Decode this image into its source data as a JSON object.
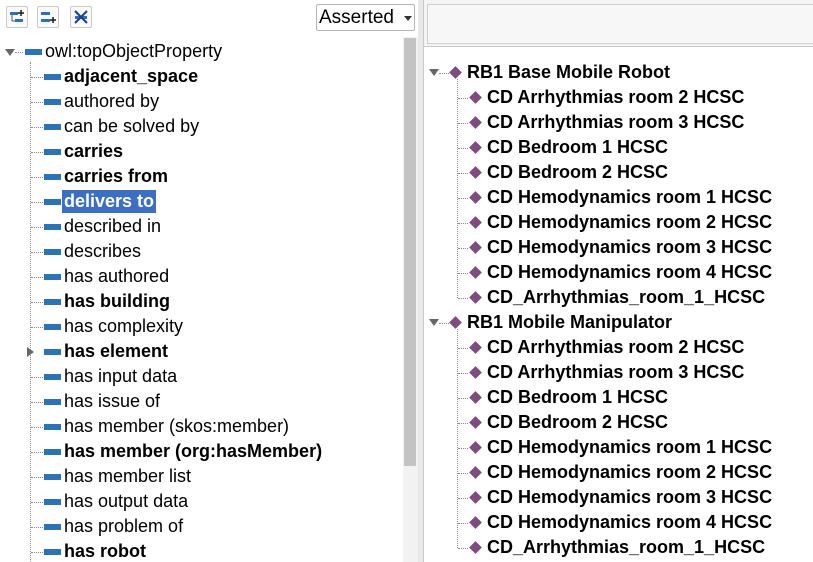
{
  "toolbar": {
    "buttons": [
      {
        "icon": "add-sub-property-icon"
      },
      {
        "icon": "add-sibling-property-icon"
      },
      {
        "icon": "delete-property-icon"
      }
    ],
    "view_mode": "Asserted"
  },
  "property_tree": {
    "root": "owl:topObjectProperty",
    "items": [
      {
        "label": "adjacent_space",
        "bold": true
      },
      {
        "label": "authored by",
        "bold": false
      },
      {
        "label": "can be solved by",
        "bold": false
      },
      {
        "label": "carries",
        "bold": true
      },
      {
        "label": "carries from",
        "bold": true
      },
      {
        "label": "delivers to",
        "bold": true,
        "selected": true
      },
      {
        "label": "described in",
        "bold": false
      },
      {
        "label": "describes",
        "bold": false
      },
      {
        "label": "has authored",
        "bold": false
      },
      {
        "label": "has building",
        "bold": true
      },
      {
        "label": "has complexity",
        "bold": false
      },
      {
        "label": "has element",
        "bold": true,
        "expandable": true
      },
      {
        "label": "has input data",
        "bold": false
      },
      {
        "label": "has issue of",
        "bold": false
      },
      {
        "label": "has member (skos:member)",
        "bold": false
      },
      {
        "label": "has member (org:hasMember)",
        "bold": true
      },
      {
        "label": "has member list",
        "bold": false
      },
      {
        "label": "has output data",
        "bold": false
      },
      {
        "label": "has problem of",
        "bold": false
      },
      {
        "label": "has robot",
        "bold": true
      }
    ]
  },
  "usage_tree": {
    "groups": [
      {
        "label": "RB1 Base Mobile Robot",
        "children": [
          "CD Arrhythmias room 2 HCSC",
          "CD Arrhythmias room 3 HCSC",
          "CD Bedroom 1 HCSC",
          "CD Bedroom 2 HCSC",
          "CD Hemodynamics room 1 HCSC",
          "CD Hemodynamics room 2 HCSC",
          "CD Hemodynamics room 3 HCSC",
          "CD Hemodynamics room 4 HCSC",
          "CD_Arrhythmias_room_1_HCSC"
        ]
      },
      {
        "label": "RB1 Mobile Manipulator",
        "children": [
          "CD Arrhythmias room 2 HCSC",
          "CD Arrhythmias room 3 HCSC",
          "CD Bedroom 1 HCSC",
          "CD Bedroom 2 HCSC",
          "CD Hemodynamics room 1 HCSC",
          "CD Hemodynamics room 2 HCSC",
          "CD Hemodynamics room 3 HCSC",
          "CD Hemodynamics room 4 HCSC",
          "CD_Arrhythmias_room_1_HCSC"
        ]
      }
    ]
  },
  "colors": {
    "property_bar": "#2b73b5",
    "individual_diamond": "#7d4d7d",
    "selection": "#3c6fbf"
  }
}
